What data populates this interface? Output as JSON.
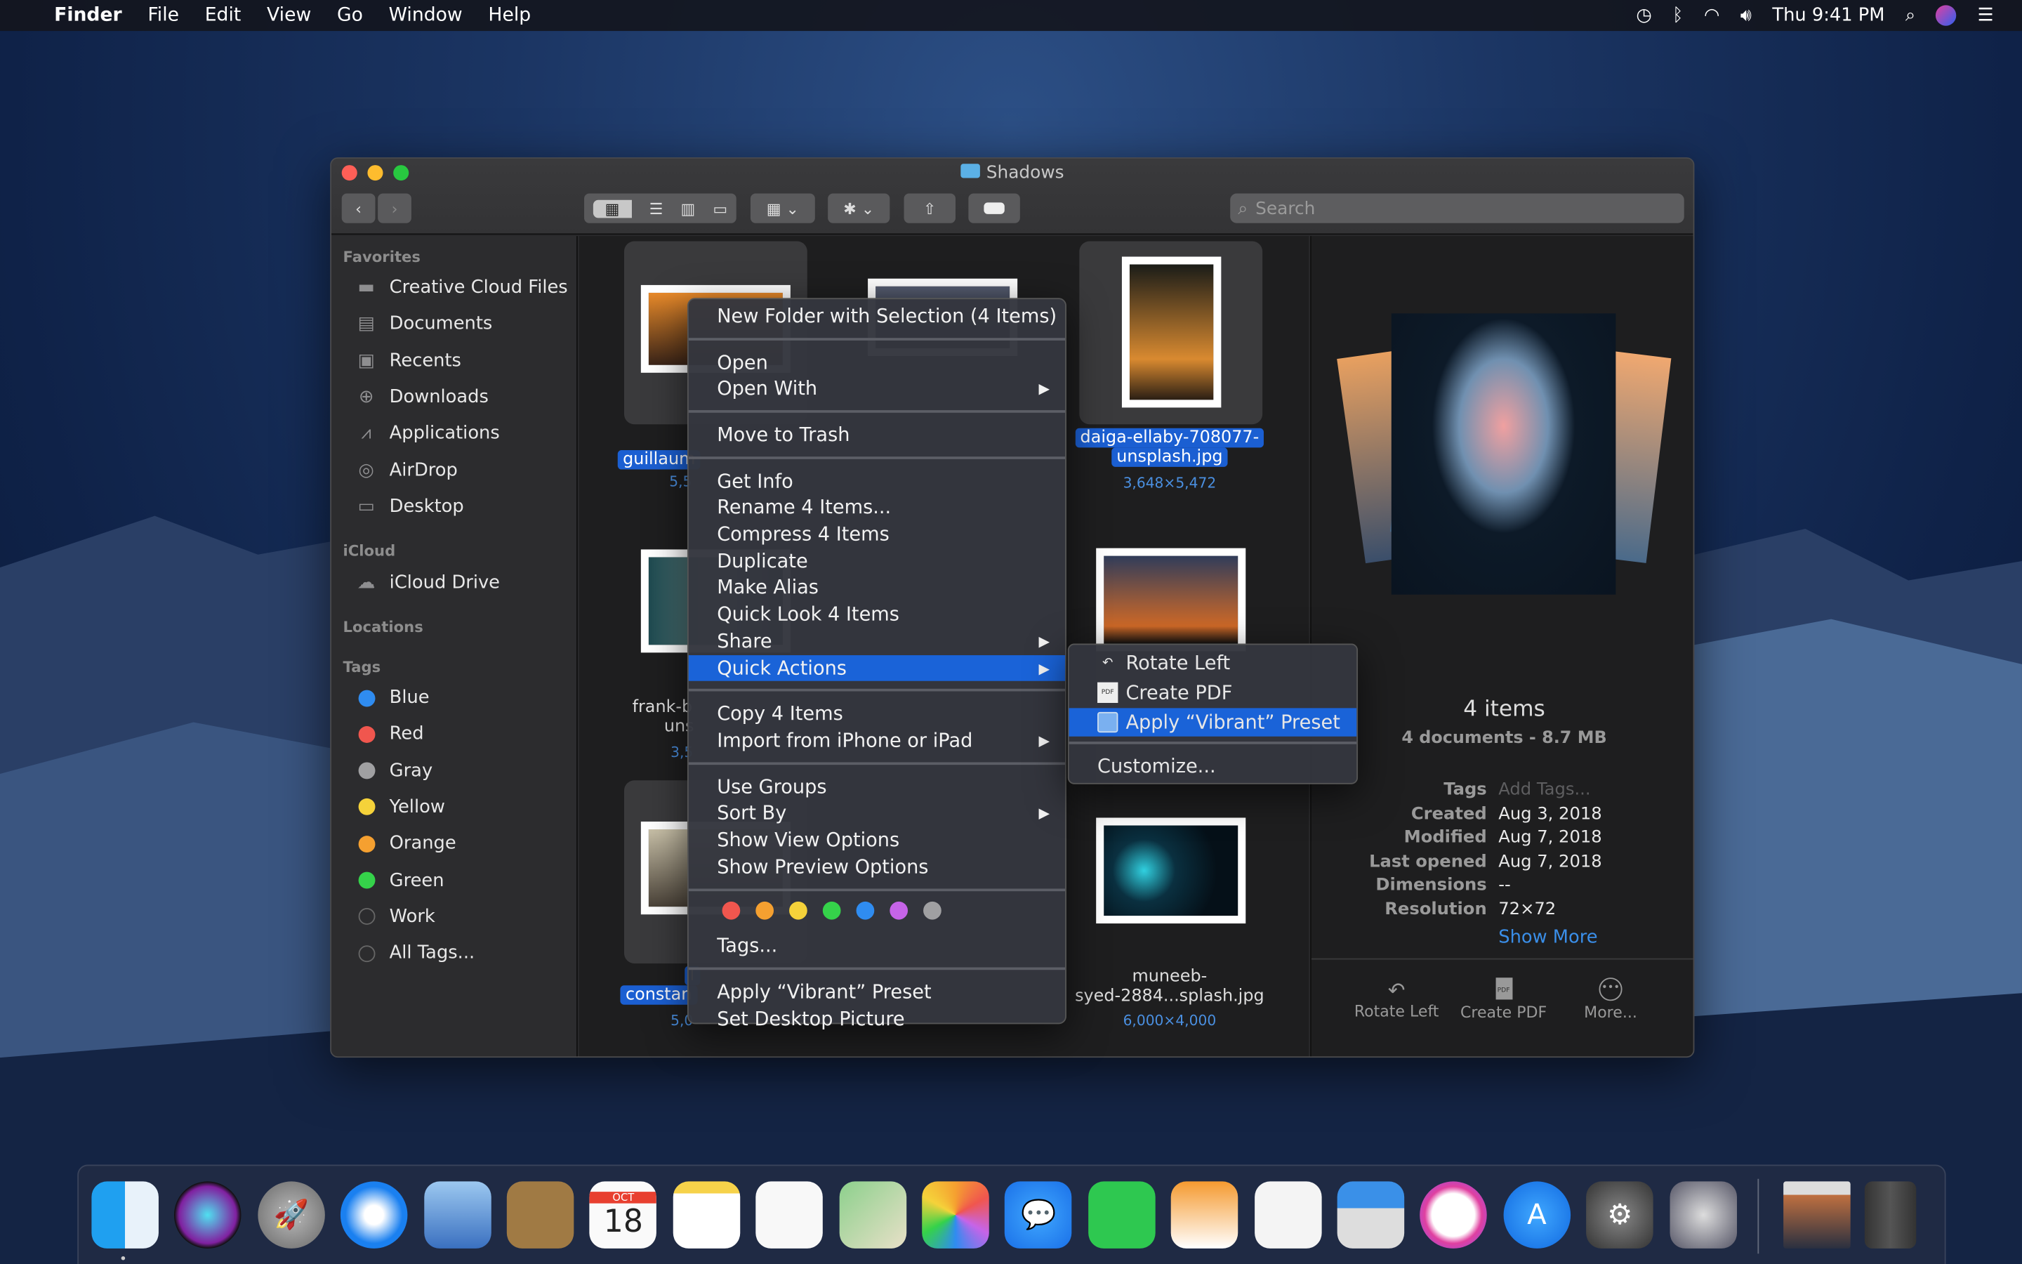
{
  "menubar": {
    "apple_icon": "apple-logo",
    "app": "Finder",
    "items": [
      "File",
      "Edit",
      "View",
      "Go",
      "Window",
      "Help"
    ],
    "clock": "Thu 9:41 PM",
    "status_icons": [
      "time-machine-icon",
      "bluetooth-icon",
      "wifi-icon",
      "volume-icon",
      "spotlight-icon",
      "siri-icon",
      "notification-center-icon"
    ]
  },
  "window": {
    "title": "Shadows",
    "search_placeholder": "Search",
    "toolbar": [
      "back",
      "forward",
      "icon-view",
      "list-view",
      "column-view",
      "gallery-view",
      "group-by",
      "action",
      "share",
      "tags"
    ]
  },
  "sidebar": {
    "favorites_label": "Favorites",
    "favorites": [
      {
        "label": "Creative Cloud Files",
        "icon": "folder-icon"
      },
      {
        "label": "Documents",
        "icon": "documents-icon"
      },
      {
        "label": "Recents",
        "icon": "recents-icon"
      },
      {
        "label": "Downloads",
        "icon": "downloads-icon"
      },
      {
        "label": "Applications",
        "icon": "applications-icon"
      },
      {
        "label": "AirDrop",
        "icon": "airdrop-icon"
      },
      {
        "label": "Desktop",
        "icon": "desktop-icon"
      }
    ],
    "icloud_label": "iCloud",
    "icloud": [
      {
        "label": "iCloud Drive",
        "icon": "cloud-icon"
      }
    ],
    "locations_label": "Locations",
    "tags_label": "Tags",
    "tags": [
      {
        "label": "Blue",
        "color": "#2f8cf0"
      },
      {
        "label": "Red",
        "color": "#f0564e"
      },
      {
        "label": "Gray",
        "color": "#a0a0a2"
      },
      {
        "label": "Yellow",
        "color": "#f5d23a"
      },
      {
        "label": "Orange",
        "color": "#f5a030"
      },
      {
        "label": "Green",
        "color": "#35d24a"
      },
      {
        "label": "Work",
        "color": ""
      },
      {
        "label": "All Tags...",
        "color": ""
      }
    ]
  },
  "files": [
    {
      "name": "guillaum",
      "size": "5,5",
      "selected": true
    },
    {
      "name": "daiga-ellaby-708077-",
      "name2": "unsplash.jpg",
      "size": "3,648×5,472",
      "selected": true
    },
    {
      "name": "frank-b",
      "name2": "uns",
      "size": "3,5",
      "selected": false
    },
    {
      "name": "constan",
      "name0": "l",
      "size": "5,0",
      "selected": true
    },
    {
      "name": "muneeb-",
      "name2": "syed-2884...splash.jpg",
      "size": "6,000×4,000",
      "selected": false
    }
  ],
  "context_menu": {
    "groups": [
      [
        {
          "label": "New Folder with Selection (4 Items)"
        }
      ],
      [
        {
          "label": "Open"
        },
        {
          "label": "Open With",
          "submenu": true
        }
      ],
      [
        {
          "label": "Move to Trash"
        }
      ],
      [
        {
          "label": "Get Info"
        },
        {
          "label": "Rename 4 Items..."
        },
        {
          "label": "Compress 4 Items"
        },
        {
          "label": "Duplicate"
        },
        {
          "label": "Make Alias"
        },
        {
          "label": "Quick Look 4 Items"
        },
        {
          "label": "Share",
          "submenu": true
        },
        {
          "label": "Quick Actions",
          "submenu": true,
          "highlighted": true
        }
      ],
      [
        {
          "label": "Copy 4 Items"
        },
        {
          "label": "Import from iPhone or iPad",
          "submenu": true
        }
      ],
      [
        {
          "label": "Use Groups"
        },
        {
          "label": "Sort By",
          "submenu": true
        },
        {
          "label": "Show View Options"
        },
        {
          "label": "Show Preview Options"
        }
      ],
      [
        {
          "label": "Tags..."
        }
      ],
      [
        {
          "label": "Apply “Vibrant” Preset"
        },
        {
          "label": "Set Desktop Picture"
        }
      ]
    ],
    "tag_colors": [
      "#f0564e",
      "#f5a030",
      "#f5d23a",
      "#35d24a",
      "#2f8cf0",
      "#c664e8",
      "#a0a0a2"
    ],
    "submenu_arrow": "▶"
  },
  "quick_actions_submenu": {
    "items": [
      {
        "label": "Rotate Left",
        "icon": "rotate-left-icon"
      },
      {
        "label": "Create PDF",
        "icon": "pdf-icon"
      },
      {
        "label": "Apply “Vibrant” Preset",
        "icon": "preset-icon",
        "highlighted": true
      }
    ],
    "customize": "Customize..."
  },
  "preview": {
    "title": "4 items",
    "subtitle": "4 documents - 8.7 MB",
    "meta": [
      {
        "key": "Tags",
        "value": "Add Tags...",
        "placeholder": true
      },
      {
        "key": "Created",
        "value": "Aug 3, 2018"
      },
      {
        "key": "Modified",
        "value": "Aug 7, 2018"
      },
      {
        "key": "Last opened",
        "value": "Aug 7, 2018"
      },
      {
        "key": "Dimensions",
        "value": "--"
      },
      {
        "key": "Resolution",
        "value": "72×72"
      }
    ],
    "show_more": "Show More",
    "actions": [
      {
        "label": "Rotate Left",
        "icon": "rotate-left-icon"
      },
      {
        "label": "Create PDF",
        "icon": "pdf-icon",
        "icon_text": "PDF"
      },
      {
        "label": "More...",
        "icon": "more-icon"
      }
    ]
  },
  "dock": {
    "apps": [
      "Finder",
      "Siri",
      "Launchpad",
      "Safari",
      "Mail",
      "Contacts",
      "Calendar",
      "Notes",
      "Reminders",
      "Maps",
      "Photos",
      "Messages",
      "FaceTime",
      "Pages",
      "Numbers",
      "Keynote",
      "iTunes",
      "App Store",
      "System Preferences",
      "Automator"
    ],
    "calendar_month": "OCT",
    "calendar_day": "18",
    "others": [
      "Downloads stack",
      "Trash"
    ]
  }
}
